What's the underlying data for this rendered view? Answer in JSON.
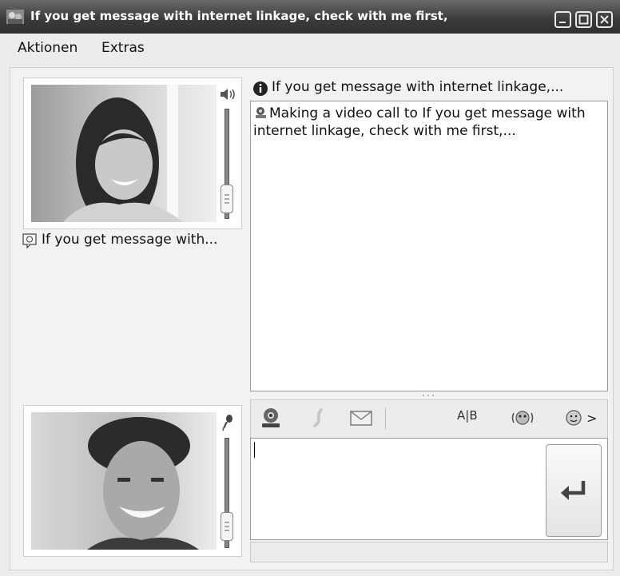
{
  "window": {
    "title": "If you get message with internet linkage, check with me first,"
  },
  "menu": {
    "items": [
      {
        "label": "Aktionen"
      },
      {
        "label": "Extras"
      }
    ]
  },
  "contact": {
    "display_name": "If you get message with internet linkage,...",
    "remote_caption": "If you get message with..."
  },
  "chat": {
    "messages": [
      {
        "icon": "webcam-icon",
        "text": "Making a video call to If you get message with internet linkage, check with me first,..."
      }
    ]
  },
  "toolbar": {
    "buttons": [
      "webcam-icon",
      "phone-icon",
      "mail-icon",
      "spellcheck-icon",
      "nudge-icon",
      "emoticon-icon"
    ],
    "spell_label": "A|B",
    "more_label": ">"
  },
  "input": {
    "value": ""
  },
  "colors": {
    "titlebar": "#3c3c3c",
    "background": "#ececec",
    "border": "#9a9a9a"
  }
}
